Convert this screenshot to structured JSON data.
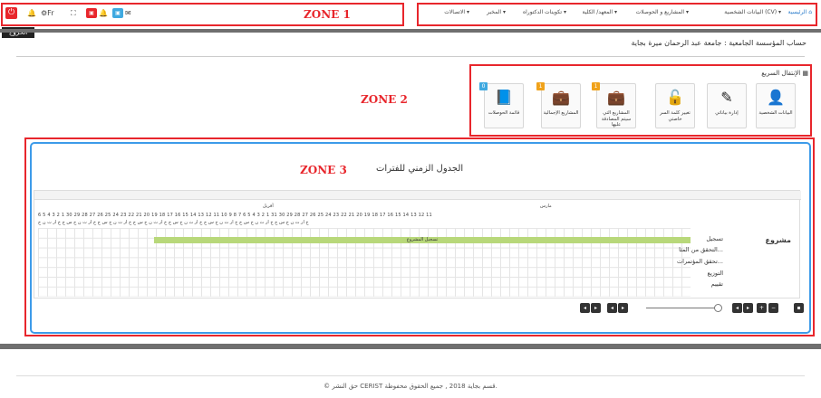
{
  "zones": {
    "zone1": "ZONE 1",
    "zone2": "ZONE 2",
    "zone3": "ZONE 3"
  },
  "toolbar": {
    "exit_tooltip": "الخروج",
    "lang": "Fr",
    "badges": [
      {
        "value": "",
        "color": "#e8262c"
      },
      {
        "value": "",
        "color": "#3fa9e0"
      }
    ]
  },
  "nav": [
    {
      "label": "الرئيسية",
      "icon": "home-icon"
    },
    {
      "label": "البيانات الشخصية (CV)",
      "icon": "user-icon"
    },
    {
      "label": "المشاريع و الحوصلات",
      "icon": "briefcase-icon"
    },
    {
      "label": "المعهد/ الكلية",
      "icon": "building-icon"
    },
    {
      "label": "تكوينات الدكتوراه",
      "icon": "graduation-icon"
    },
    {
      "label": "المخبر",
      "icon": "lab-icon"
    },
    {
      "label": "الاتصالات",
      "icon": "phone-icon"
    }
  ],
  "account": "حساب المؤسسة الجامعية : جامعة عبد الرحمان ميرة بجاية",
  "quick_nav": {
    "title": "الإنتقال السريع",
    "items": [
      {
        "label": "البيانات الشخصية",
        "icon": "user-icon",
        "badge": ""
      },
      {
        "label": "إدارة بياناتي",
        "icon": "pencil-icon",
        "badge": ""
      },
      {
        "label": "تغيير كلمة السر خاصتي",
        "icon": "lock-icon",
        "badge": ""
      },
      {
        "label": "المشاريع التي سيتم المصادقة عليها",
        "icon": "briefcase-icon",
        "badge": "1"
      },
      {
        "label": "المشاريع الإجمالية",
        "icon": "briefcase-icon",
        "badge": "1"
      },
      {
        "label": "قائمة الحوصلات",
        "icon": "book-icon",
        "badge": "0"
      }
    ]
  },
  "timeline": {
    "title": "الجدول الزمني للفترات",
    "months": [
      "أفريل",
      "مارس"
    ],
    "days": "6 5 4 3 2 1 30 29 28 27 26 25 24 23 22 21 20 19 18 17 16 15 14 13 12 11 10 9 8 7 6 5 4 3 2 1 31 30 29 28 27 26 25 24 23 22 21 20 19 18 17 16 15 14 13 12 11",
    "weekdays": "خ ار ث ن ح س ج خ ار ث ن ح س ج خ ار ث ن ح س ج خ ار ث ن ح س ج خ ار ث ن ح س ج خ ار ث ن ح س ج خ ار ث ن ح س ج خ ار ث ن ح",
    "bar_label": "تسجيل المشروع",
    "project_label": "مشروع",
    "rows": [
      "تسجيل",
      "التحقق من المثا...",
      "تحقق المؤتمرات...",
      "التوزيع",
      "تقييم"
    ]
  },
  "footer": "© حق النشر CERIST قسم بجاية 2018 , جميع الحقوق محفوظة."
}
